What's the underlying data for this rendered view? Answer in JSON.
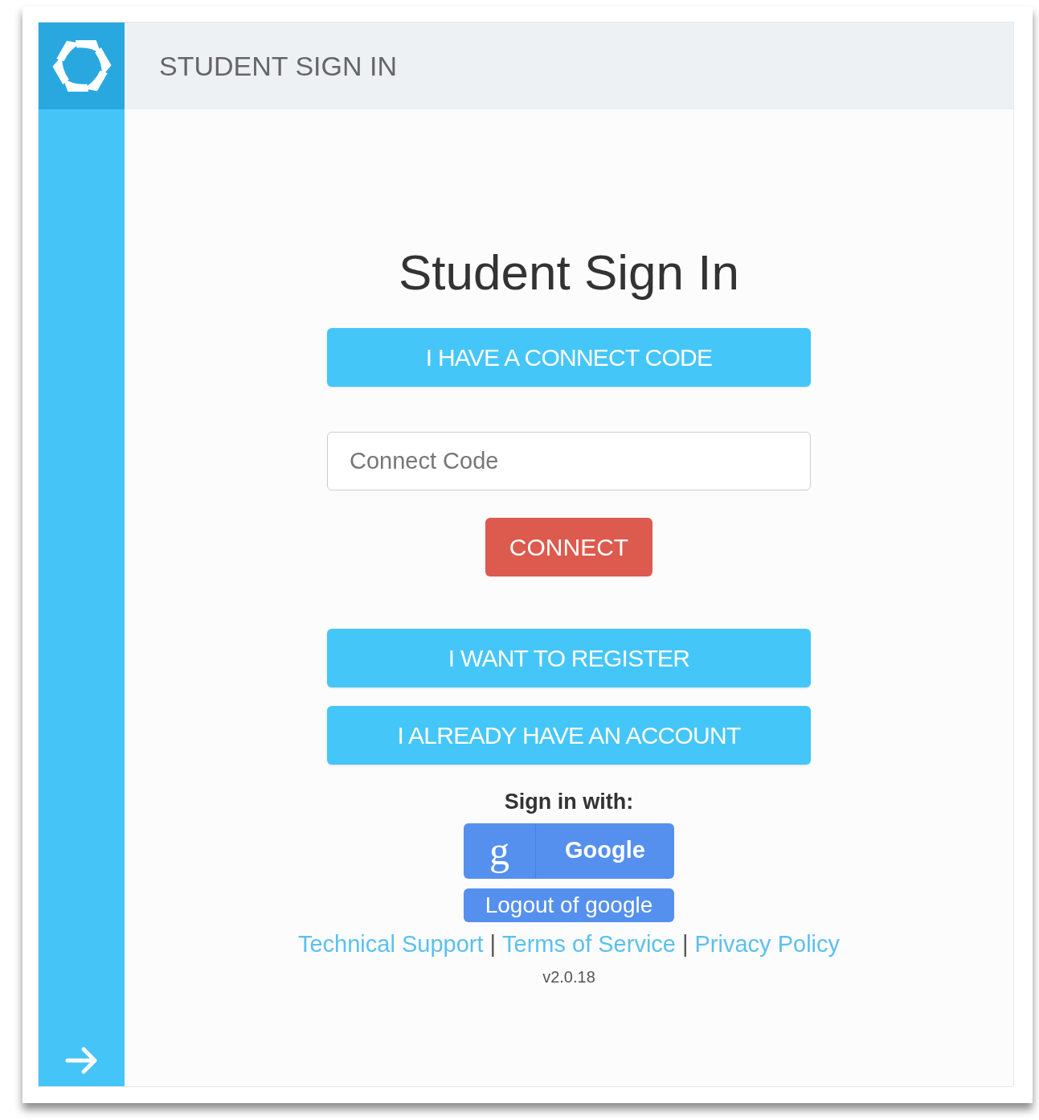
{
  "header": {
    "title": "STUDENT SIGN IN"
  },
  "heading": "Student Sign In",
  "connect_code_button": "I HAVE A CONNECT CODE",
  "connect_code_field": {
    "placeholder": "Connect Code"
  },
  "connect_button": "CONNECT",
  "register_button": "I WANT TO REGISTER",
  "account_button": "I ALREADY HAVE AN ACCOUNT",
  "sign_in_with": "Sign in with:",
  "google_button": {
    "glyph": "g",
    "label": "Google"
  },
  "logout_button": "Logout of google",
  "footer_links": [
    "Technical Support",
    "Terms of Service",
    "Privacy Policy"
  ],
  "separator": "|",
  "version": "v2.0.18"
}
